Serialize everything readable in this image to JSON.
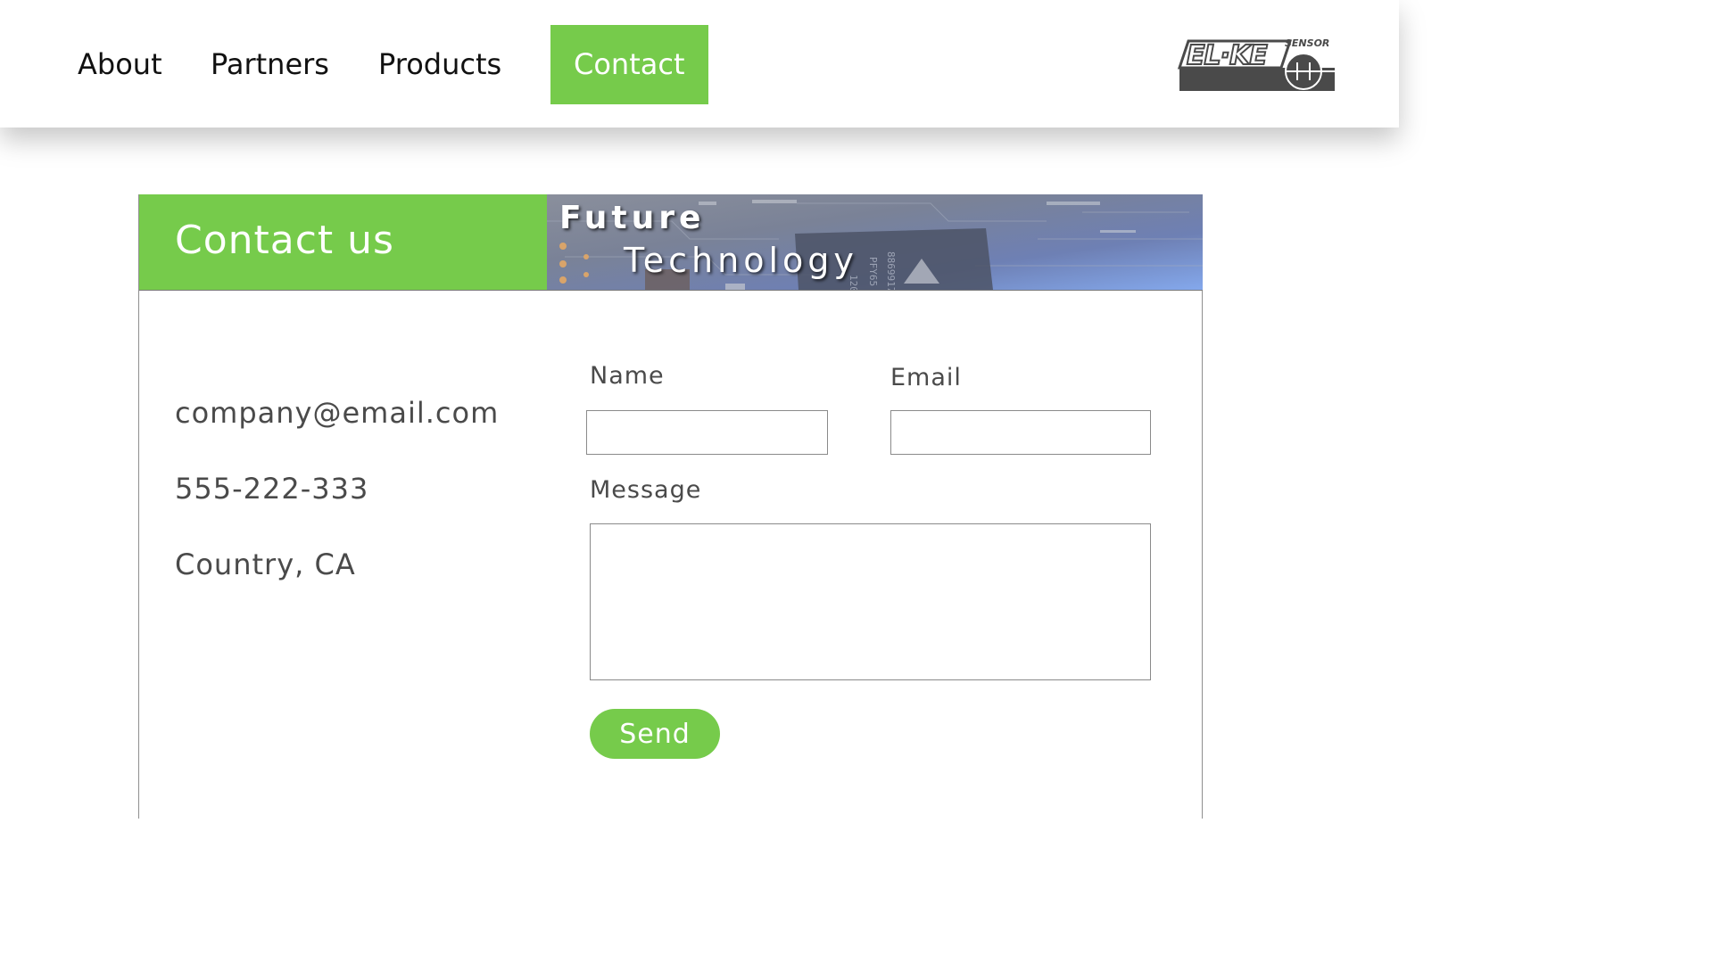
{
  "nav": {
    "items": [
      {
        "label": "About"
      },
      {
        "label": "Partners"
      },
      {
        "label": "Products"
      },
      {
        "label": "Contact",
        "active": true
      }
    ]
  },
  "logo": {
    "text": "EL-KE",
    "subtext": "SENSOR"
  },
  "contact_card": {
    "title": "Contact us",
    "banner": {
      "line1": "Future",
      "line2": "Technology"
    },
    "info": {
      "email": "company@email.com",
      "phone": "555-222-333",
      "location": "Country, CA"
    },
    "form": {
      "name_label": "Name",
      "name_value": "",
      "email_label": "Email",
      "email_value": "",
      "message_label": "Message",
      "message_value": "",
      "send_label": "Send"
    }
  },
  "colors": {
    "accent": "#76cb4b",
    "text": "#4a4a4a",
    "nav_text": "#111111"
  }
}
